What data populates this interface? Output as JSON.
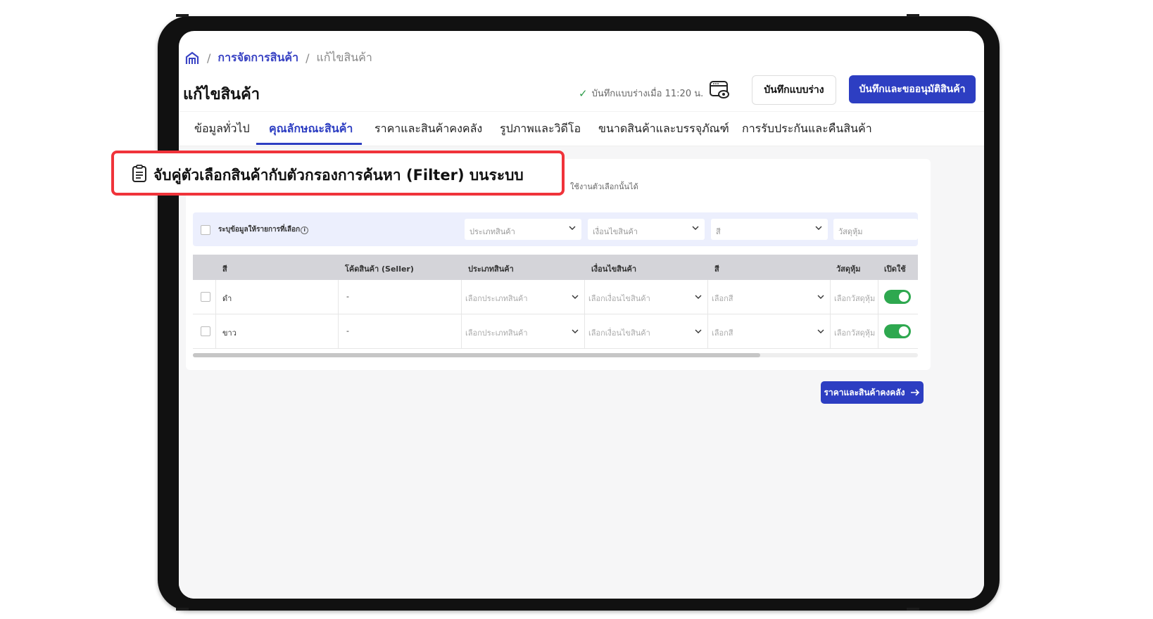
{
  "breadcrumb": {
    "separator": "/",
    "parent": "การจัดการสินค้า",
    "current": "แก้ไขสินค้า"
  },
  "header": {
    "title": "แก้ไขสินค้า",
    "saved_status": "บันทึกแบบร่างเมื่อ 11:20 น.",
    "draft_label": "บันทึกแบบร่าง",
    "submit_label": "บันทึกและขออนุมัติสินค้า"
  },
  "tabs": [
    {
      "label": "ข้อมูลทั่วไป"
    },
    {
      "label": "คุณลักษณะสินค้า"
    },
    {
      "label": "ราคาและสินค้าคงคลัง"
    },
    {
      "label": "รูปภาพและวิดีโอ"
    },
    {
      "label": "ขนาดสินค้าและบรรจุภัณฑ์"
    },
    {
      "label": "การรับประกันและคืนสินค้า"
    }
  ],
  "callout": {
    "title": "จับคู่ตัวเลือกสินค้ากับตัวกรองการค้นหา (Filter) บนระบบ"
  },
  "section": {
    "note": "ใช้งานตัวเลือกนั้นได้"
  },
  "bulk": {
    "label": "ระบุข้อมูลให้รายการที่เลือก",
    "type_placeholder": "ประเภทสินค้า",
    "condition_placeholder": "เงื่อนไขสินค้า",
    "color_placeholder": "สี",
    "material_placeholder": "วัสดุหุ้ม"
  },
  "table": {
    "headers": [
      "สี",
      "โค้ดสินค้า (Seller)",
      "ประเภทสินค้า",
      "เงื่อนไขสินค้า",
      "สี",
      "วัสดุหุ้ม",
      "เปิดใช้"
    ],
    "rows": [
      {
        "color": "ดำ",
        "code": "-",
        "type": "เลือกประเภทสินค้า",
        "condition": "เลือกเงื่อนไขสินค้า",
        "color_select": "เลือกสี",
        "material": "เลือกวัสดุหุ้ม"
      },
      {
        "color": "ขาว",
        "code": "-",
        "type": "เลือกประเภทสินค้า",
        "condition": "เลือกเงื่อนไขสินค้า",
        "color_select": "เลือกสี",
        "material": "เลือกวัสดุหุ้ม"
      }
    ]
  },
  "footer": {
    "next_label": "ราคาและสินค้าคงคลัง"
  },
  "icons": {
    "home": "home-icon",
    "check": "check-icon",
    "preview": "preview-icon",
    "chevron": "chevron-down-icon",
    "arrow": "arrow-right-icon",
    "callout": "clipboard-list-icon"
  },
  "colors": {
    "accent": "#2d3ec2",
    "toggle_on": "#2ea84f",
    "callout_border": "#f0333a"
  }
}
